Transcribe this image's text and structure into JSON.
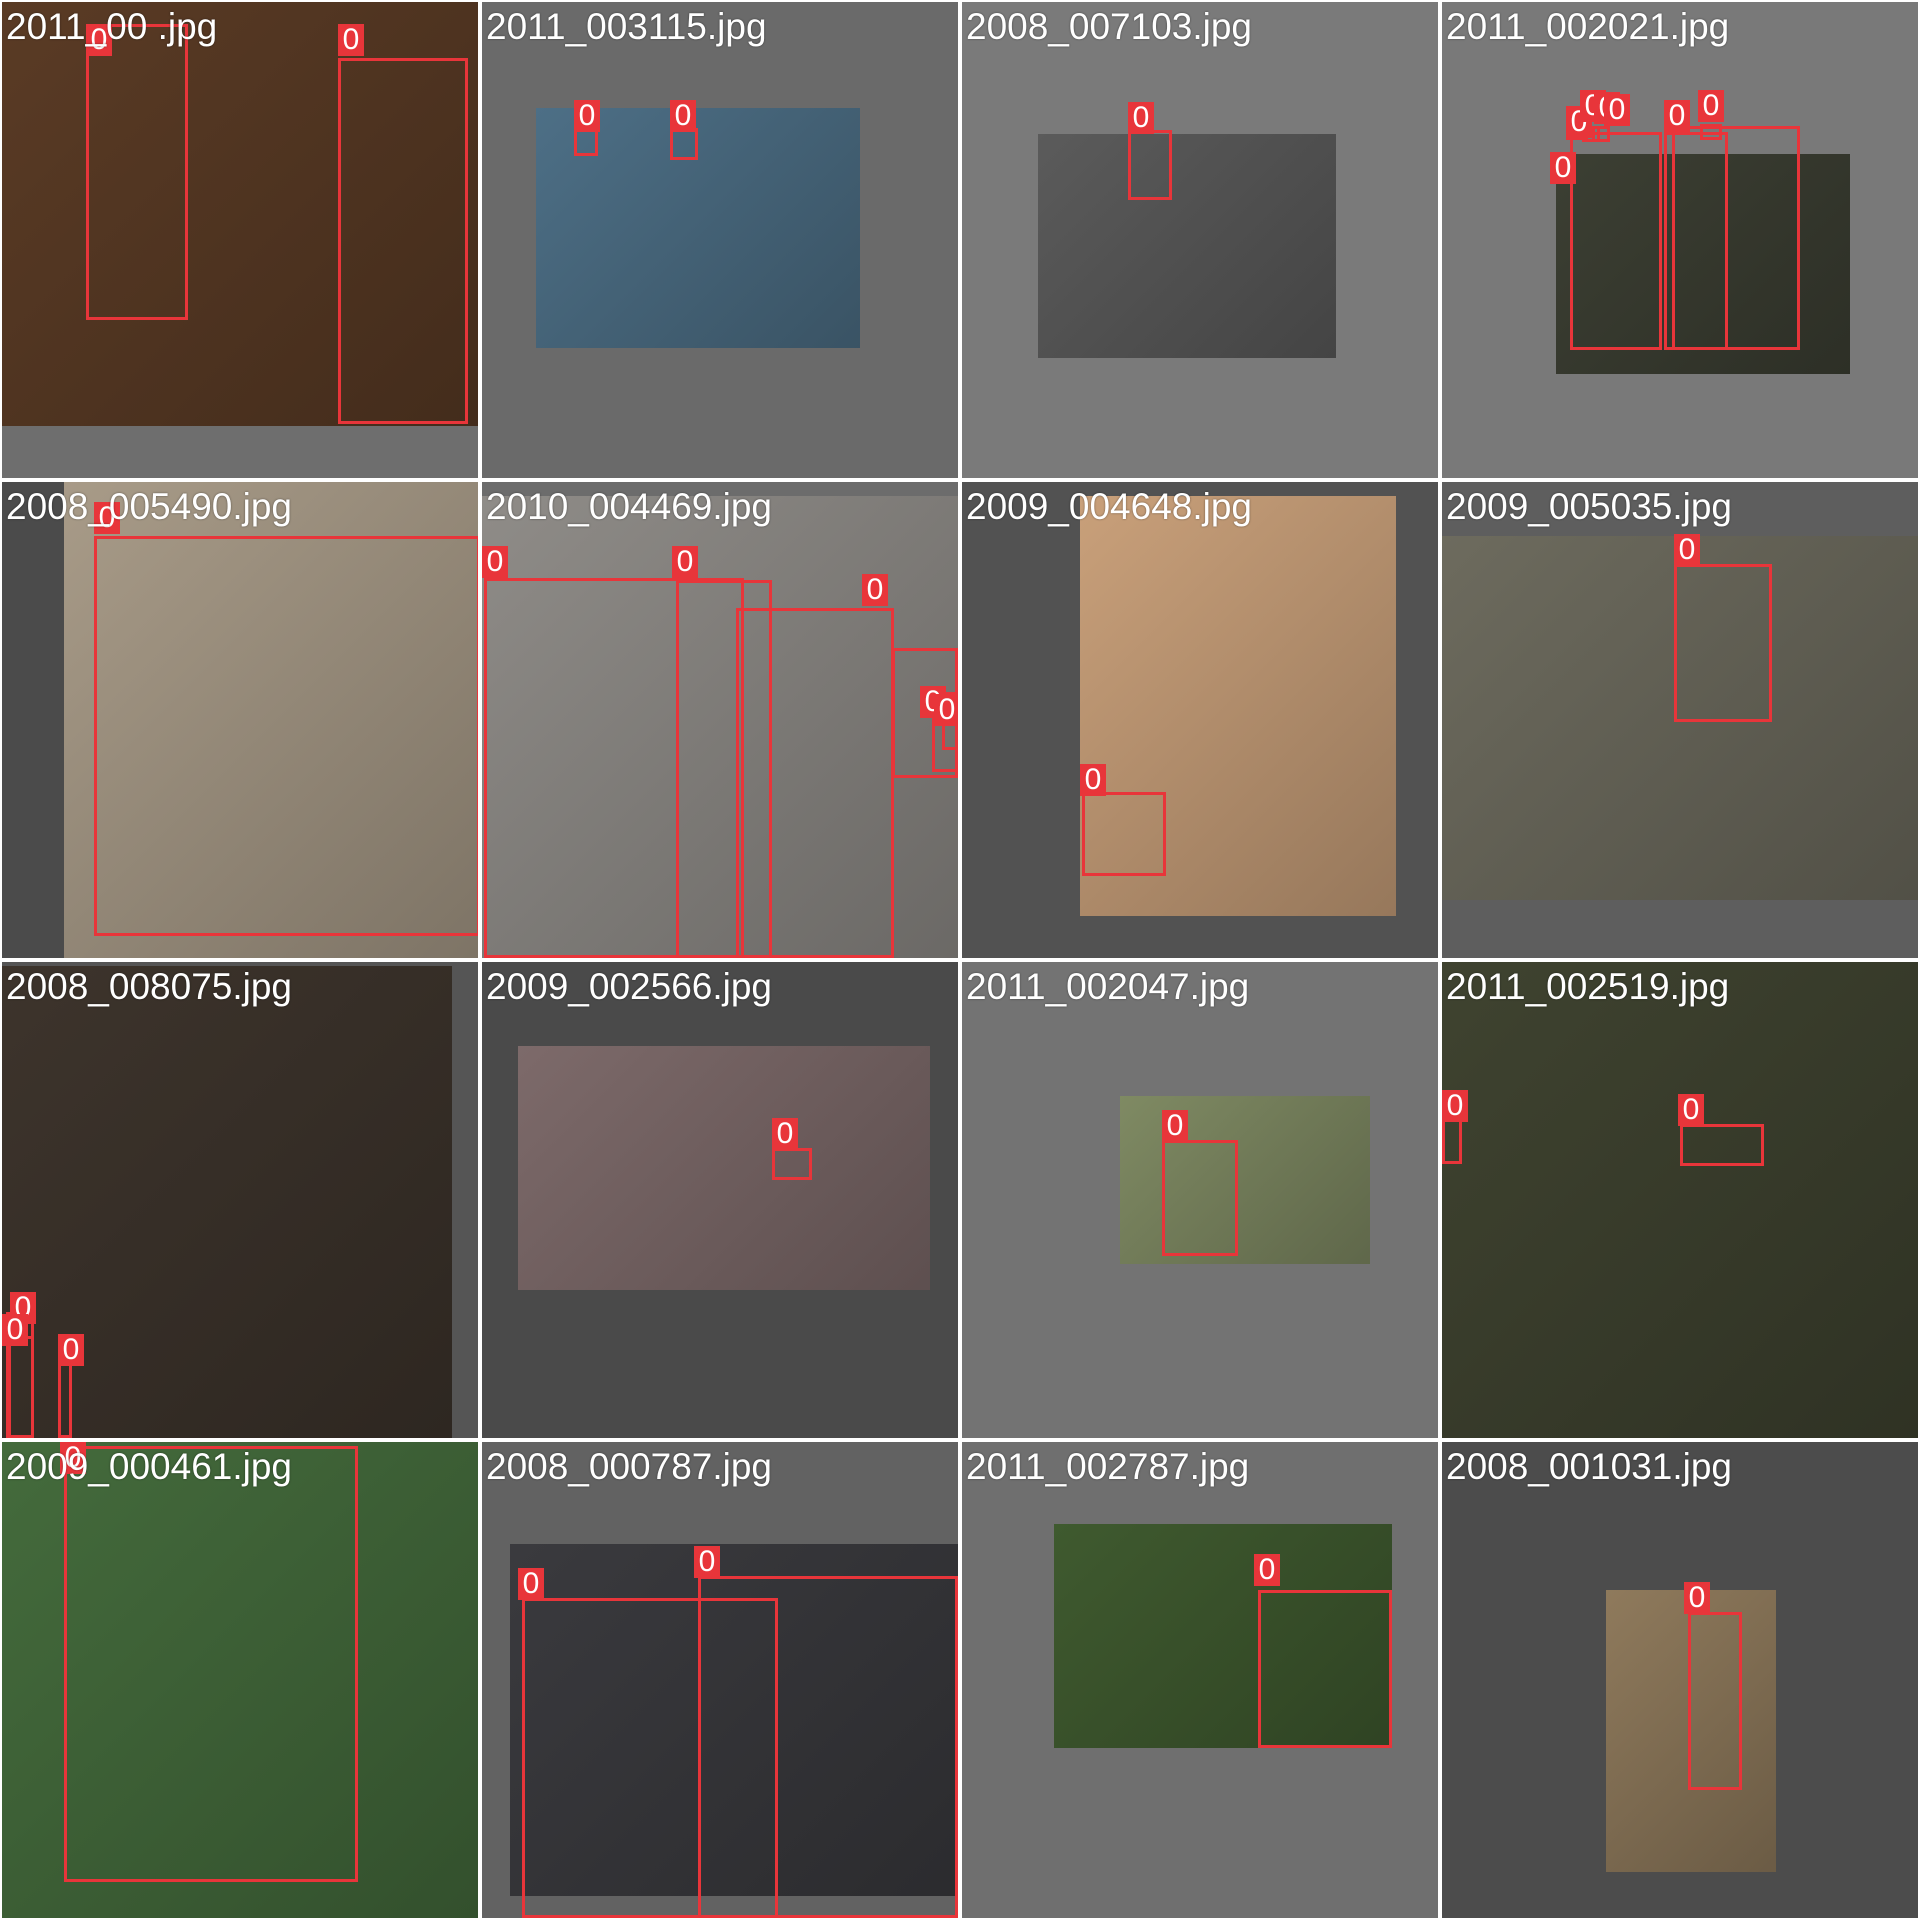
{
  "colors": {
    "box": "#e8353a",
    "label_text": "#ffffff",
    "filename_text": "#ffffff",
    "grid_gap": "#ffffff"
  },
  "tiles": [
    {
      "filename": "2011_00    .jpg",
      "label": "0",
      "bg": "#6e6e6e",
      "photo": "#5a3b25",
      "boxes": 2
    },
    {
      "filename": "2011_003115.jpg",
      "label": "0",
      "bg": "#6a6a6a",
      "photo": "#4d6f86",
      "boxes": 2
    },
    {
      "filename": "2008_007103.jpg",
      "label": "0",
      "bg": "#7a7a7a",
      "photo": "#5b5b5b",
      "boxes": 1
    },
    {
      "filename": "2011_002021.jpg",
      "label": "0",
      "bg": "#797979",
      "photo": "#3c3f33",
      "boxes": 7
    },
    {
      "filename": "2008_005490.jpg",
      "label": "0",
      "bg": "#4b4b4b",
      "photo": "#a89b88",
      "boxes": 1
    },
    {
      "filename": "2010_004469.jpg",
      "label": "0",
      "bg": "#6c6c6c",
      "photo": "#8f8c88",
      "boxes": 6
    },
    {
      "filename": "2009_004648.jpg",
      "label": "0",
      "bg": "#525252",
      "photo": "#c9a07a",
      "boxes": 1
    },
    {
      "filename": "2009_005035.jpg",
      "label": "0",
      "bg": "#5e5e5e",
      "photo": "#6d6b5e",
      "boxes": 1
    },
    {
      "filename": "2008_008075.jpg",
      "label": "0",
      "bg": "#555555",
      "photo": "#3d342c",
      "boxes": 3
    },
    {
      "filename": "2009_002566.jpg",
      "label": "0",
      "bg": "#4a4a4a",
      "photo": "#7d6a6a",
      "boxes": 1
    },
    {
      "filename": "2011_002047.jpg",
      "label": "0",
      "bg": "#737373",
      "photo": "#7f8a63",
      "boxes": 1
    },
    {
      "filename": "2011_002519.jpg",
      "label": "0",
      "bg": "#575757",
      "photo": "#3f4330",
      "boxes": 2
    },
    {
      "filename": "2009_000461.jpg",
      "label": "0",
      "bg": "#5c5c5c",
      "photo": "#446b3c",
      "boxes": 1
    },
    {
      "filename": "2008_000787.jpg",
      "label": "0",
      "bg": "#626262",
      "photo": "#3a3a3e",
      "boxes": 2
    },
    {
      "filename": "2011_002787.jpg",
      "label": "0",
      "bg": "#6f6f6f",
      "photo": "#3f5a2f",
      "boxes": 1
    },
    {
      "filename": "2008_001031.jpg",
      "label": "0",
      "bg": "#4c4c4c",
      "photo": "#8f7a5c",
      "boxes": 1
    }
  ]
}
